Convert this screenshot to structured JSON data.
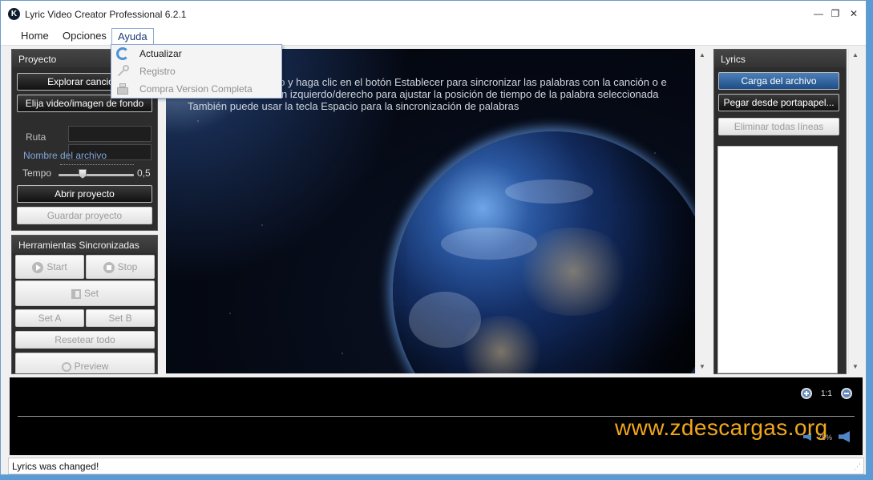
{
  "window": {
    "title": "Lyric Video Creator Professional 6.2.1",
    "icon_letter": "K",
    "minimize": "—",
    "maximize": "❐",
    "close": "✕"
  },
  "menubar": {
    "items": [
      "Home",
      "Opciones",
      "Ayuda"
    ],
    "active": "Ayuda"
  },
  "ayuda_menu": {
    "items": [
      {
        "label": "Actualizar",
        "enabled": true,
        "icon": "refresh-icon"
      },
      {
        "label": "Registro",
        "enabled": false,
        "icon": "key-icon"
      },
      {
        "label": "Compra Version Completa",
        "enabled": false,
        "icon": "cash-register-icon"
      }
    ]
  },
  "proyecto_panel": {
    "title": "Proyecto",
    "explorar_label": "Explorar canción/",
    "elija_label": "Elija video/imagen de fondo",
    "ruta_label": "Ruta",
    "ruta_value": "",
    "nombre_label": "Nombre del archivo",
    "nombre_value": "",
    "tempo_label": "Tempo",
    "tempo_value": "0,5",
    "tempo_level": 0.32,
    "abrir_label": "Abrir proyecto",
    "guardar_label": "Guardar proyecto"
  },
  "herramientas_panel": {
    "title": "Herramientas Sincronizadas",
    "start_label": "Start",
    "stop_label": "Stop",
    "set_label": "Set",
    "set_a_label": "Set A",
    "set_b_label": "Set B",
    "resetear_label": "Resetear todo",
    "preview_label": "Preview"
  },
  "video": {
    "instructions": [
      "eo y haga clic en el botón Establecer para sincronizar las palabras con la canción o e",
      "n izquierdo/derecho para ajustar la posición de tiempo de la palabra seleccionada",
      "También puede usar la tecla Espacio para la sincronización de palabras"
    ]
  },
  "lyrics_panel": {
    "title": "Lyrics",
    "carga_label": "Carga del archivo",
    "pegar_label": "Pegar desde portapapel...",
    "eliminar_label": "Eliminar todas líneas",
    "text": ""
  },
  "timeline": {
    "zoom_reset_label": "1:1",
    "volume_value": "75%",
    "watermark": "www.zdescargas.org"
  },
  "status": {
    "text": "Lyrics was changed!"
  },
  "colors": {
    "panel_bg": "#2d2d2d",
    "accent_blue": "#1d4d86",
    "watermark": "#f2a71c"
  }
}
